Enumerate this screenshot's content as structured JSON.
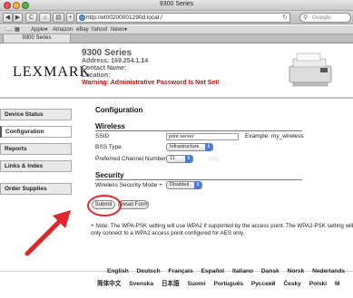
{
  "browser": {
    "window_title": "9300 Series",
    "url": "http://et00200001290d.local./",
    "search_placeholder": "Google",
    "back_glyph": "◀",
    "forward_glyph": "▶",
    "reload_glyph": "C",
    "home_glyph": "⌂",
    "print_glyph": "▤",
    "add_glyph": "+",
    "bookmarks": [
      "Apple▾",
      "Amazon",
      "eBay",
      "Yahoo!",
      "News▾"
    ],
    "tab_label": "9300 Series"
  },
  "device": {
    "logo": "LEXMARK",
    "model": "9300 Series",
    "address": "Address: 169.254.1.14",
    "contact": "Contact Name:",
    "location": "Location:",
    "warning": "Warning: Administrative Password Is Not Set!"
  },
  "sidebar": {
    "items": [
      {
        "label": "Device Status"
      },
      {
        "label": "Configuration"
      },
      {
        "label": "Reports"
      },
      {
        "label": "Links & Index"
      },
      {
        "label": "Order Supplies"
      }
    ]
  },
  "config": {
    "title": "Configuration",
    "wireless_heading": "Wireless",
    "ssid_label": "SSID",
    "ssid_value": "print server",
    "ssid_example": "Example: my_wireless",
    "bss_label": "BSS Type",
    "bss_value": "Infrastructure",
    "channel_label": "Preferred Channel Number",
    "channel_value": "11",
    "security_heading": "Security",
    "security_label": "Wireless Security Mode +",
    "security_value": "Disabled",
    "submit_label": "Submit",
    "reset_label": "Reset Form",
    "note": "+ Note: The WPA-PSK setting will use WPA2 if supported by the access point. The WPA2-PSK setting will only connect to a WPA2 access point configured for AES only."
  },
  "languages": {
    "row1": [
      "English",
      "Deutsch",
      "Français",
      "Español",
      "Italiano",
      "Dansk",
      "Norsk",
      "Nederlands"
    ],
    "row2": [
      "简体中文",
      "Svenska",
      "日本語",
      "Suomi",
      "Português",
      "Русский",
      "Česky",
      "Polski",
      "M"
    ]
  },
  "colors": {
    "warning": "#b01818",
    "annotation_red": "#e0262b",
    "select_arrow": "#4a7fd1"
  }
}
